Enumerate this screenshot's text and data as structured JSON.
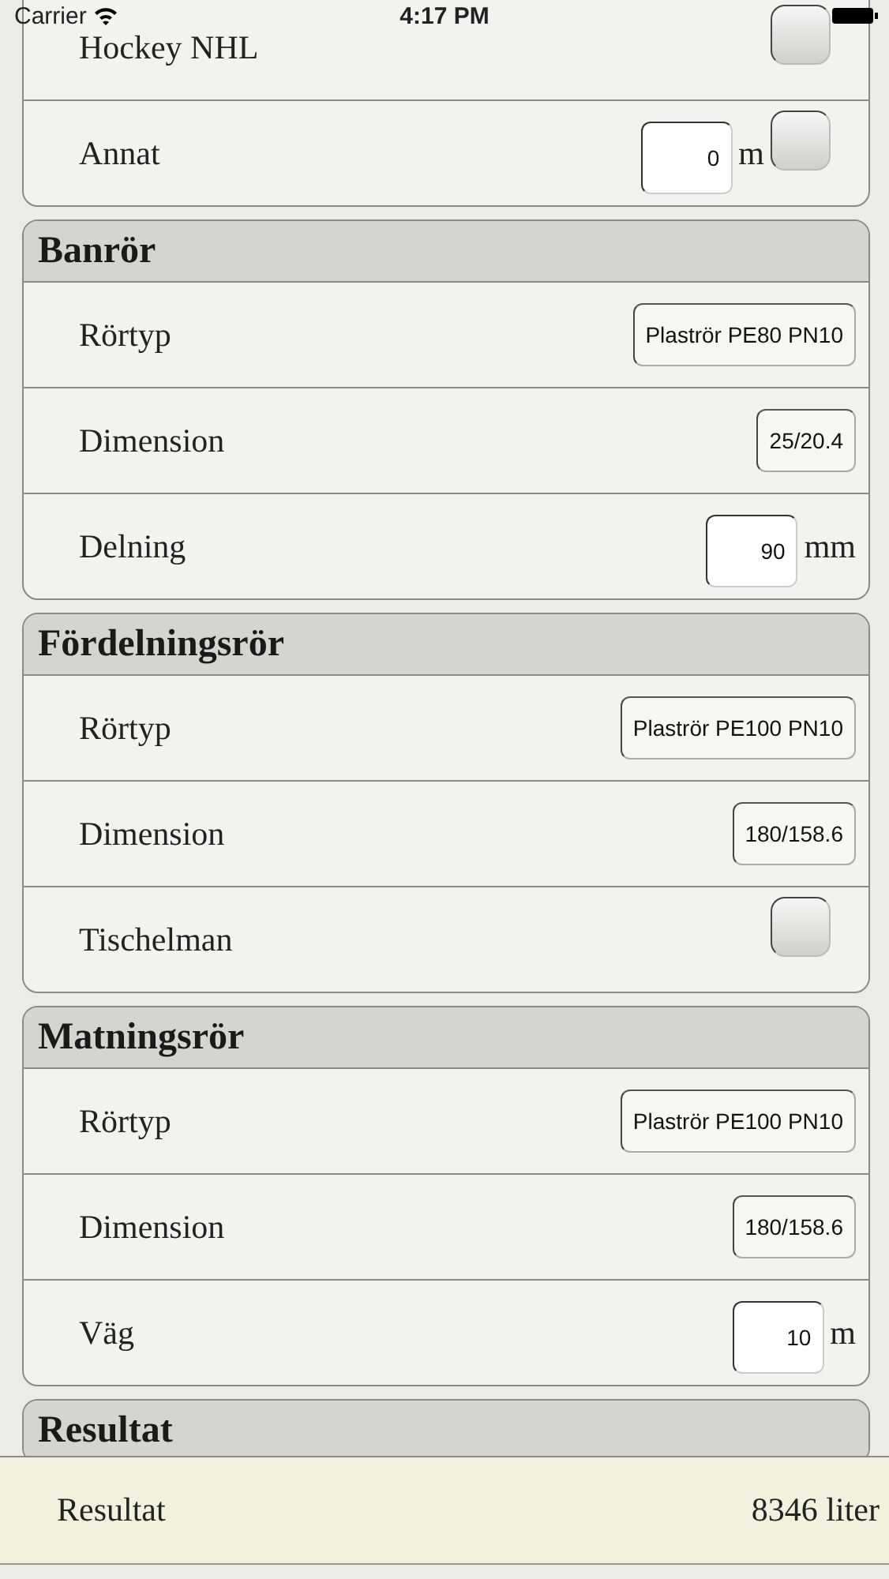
{
  "status_bar": {
    "carrier": "Carrier",
    "time": "4:17 PM"
  },
  "sections": [
    {
      "rows": [
        {
          "kind": "checkbox",
          "label": "Hockey NHL",
          "checked": false
        },
        {
          "kind": "number",
          "label": "Annat",
          "value": "0",
          "unit": "m",
          "checked": false
        }
      ]
    },
    {
      "title": "Banrör",
      "rows": [
        {
          "kind": "select",
          "label": "Rörtyp",
          "value": "Plaströr PE80 PN10"
        },
        {
          "kind": "select",
          "label": "Dimension",
          "value": "25/20.4"
        },
        {
          "kind": "number",
          "label": "Delning",
          "value": "90",
          "unit": "mm"
        }
      ]
    },
    {
      "title": "Fördelningsrör",
      "rows": [
        {
          "kind": "select",
          "label": "Rörtyp",
          "value": "Plaströr PE100 PN10"
        },
        {
          "kind": "select",
          "label": "Dimension",
          "value": "180/158.6"
        },
        {
          "kind": "checkbox",
          "label": "Tischelman",
          "checked": false
        }
      ]
    },
    {
      "title": "Matningsrör",
      "rows": [
        {
          "kind": "select",
          "label": "Rörtyp",
          "value": "Plaströr PE100 PN10"
        },
        {
          "kind": "select",
          "label": "Dimension",
          "value": "180/158.6"
        },
        {
          "kind": "number",
          "label": "Väg",
          "value": "10",
          "unit": "m"
        }
      ]
    },
    {
      "title": "Resultat"
    }
  ],
  "result_bar": {
    "label": "Resultat",
    "value": "8346 liter"
  }
}
